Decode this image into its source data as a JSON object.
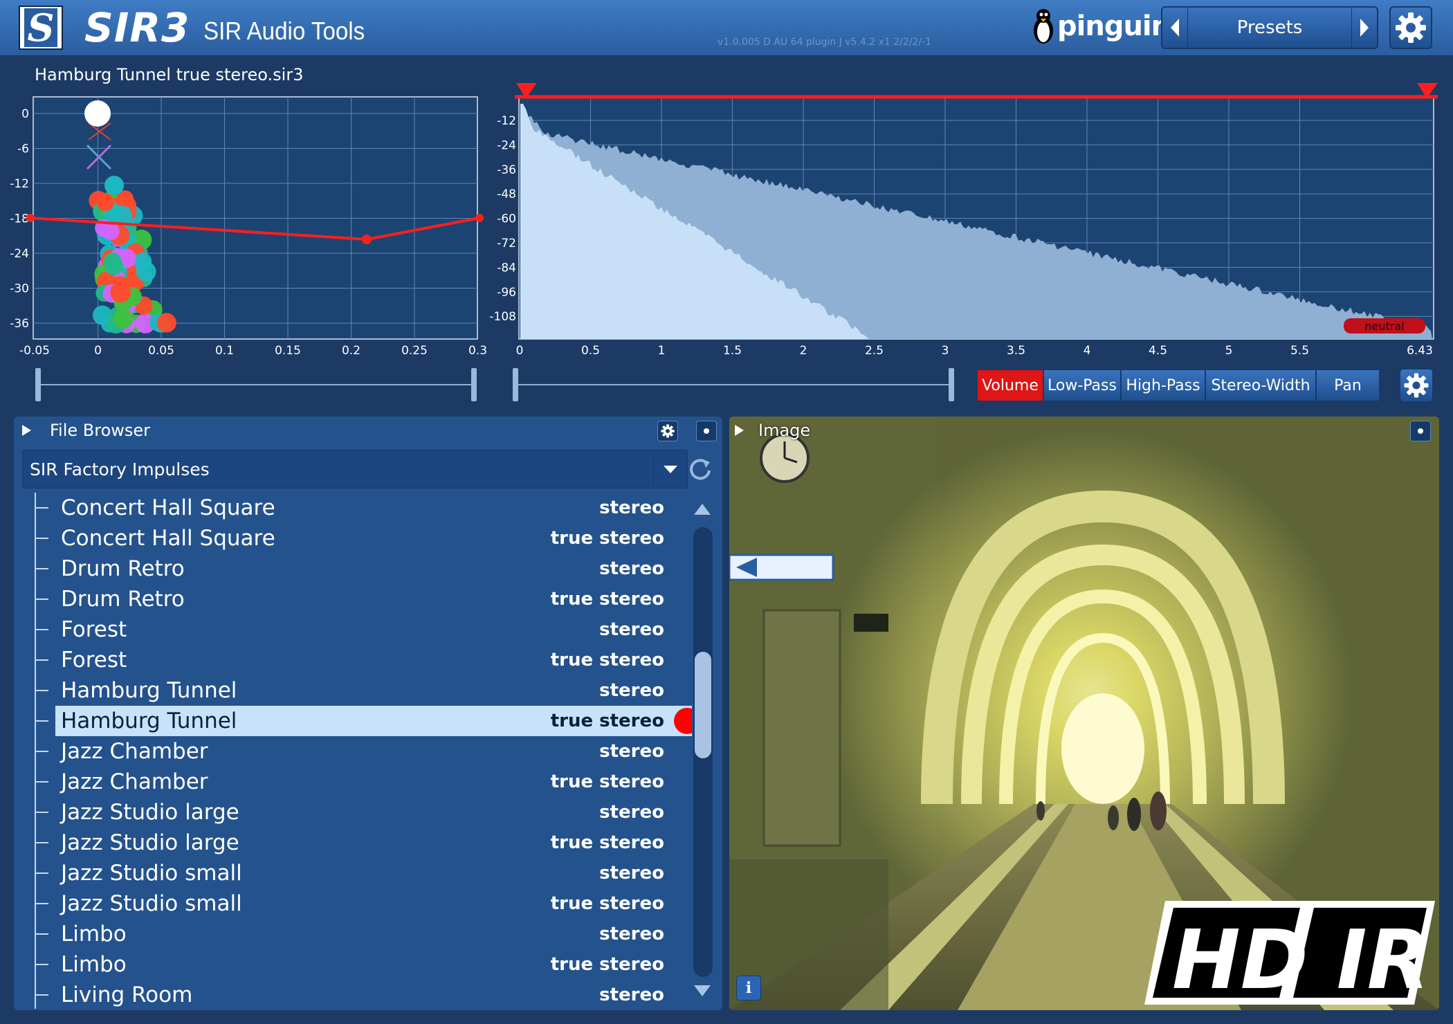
{
  "header": {
    "logo_letter": "S",
    "brand": "SIR3",
    "subtitle": "SIR Audio Tools",
    "version": "v1.0.005 D AU 64  plugin J v5.4.2 x1 2/2/2/-1",
    "pinguin": "pinguin",
    "presets_label": "Presets"
  },
  "file_title": "Hamburg Tunnel true stereo.sir3",
  "scatter": {
    "y_ticks": [
      "0",
      "-6",
      "-12",
      "-18",
      "-24",
      "-30",
      "-36"
    ],
    "x_ticks": [
      "-0.05",
      "0",
      "0.05",
      "0.1",
      "0.15",
      "0.2",
      "0.25",
      "0.3"
    ]
  },
  "envelope": {
    "y_ticks": [
      "-12",
      "-24",
      "-36",
      "-48",
      "-60",
      "-72",
      "-84",
      "-96",
      "-108"
    ],
    "x_ticks": [
      "0",
      "0.5",
      "1",
      "1.5",
      "2",
      "2.5",
      "3",
      "3.5",
      "4",
      "4.5",
      "5",
      "5.5",
      "6.43"
    ],
    "badge": "neutral"
  },
  "tabs": [
    {
      "label": "Volume",
      "active": true
    },
    {
      "label": "Low-Pass"
    },
    {
      "label": "High-Pass"
    },
    {
      "label": "Stereo-Width"
    },
    {
      "label": "Pan"
    }
  ],
  "file_browser": {
    "title": "File Browser",
    "folder": "SIR Factory Impulses",
    "rows": [
      {
        "name": "Concert Hall Square",
        "type": "stereo"
      },
      {
        "name": "Concert Hall Square",
        "type": "true stereo"
      },
      {
        "name": "Drum Retro",
        "type": "stereo"
      },
      {
        "name": "Drum Retro",
        "type": "true stereo"
      },
      {
        "name": "Forest",
        "type": "stereo"
      },
      {
        "name": "Forest",
        "type": "true stereo"
      },
      {
        "name": "Hamburg Tunnel",
        "type": "stereo"
      },
      {
        "name": "Hamburg Tunnel",
        "type": "true stereo"
      },
      {
        "name": "Jazz Chamber",
        "type": "stereo"
      },
      {
        "name": "Jazz Chamber",
        "type": "true stereo"
      },
      {
        "name": "Jazz Studio large",
        "type": "stereo"
      },
      {
        "name": "Jazz Studio large",
        "type": "true stereo"
      },
      {
        "name": "Jazz Studio small",
        "type": "stereo"
      },
      {
        "name": "Jazz Studio small",
        "type": "true stereo"
      },
      {
        "name": "Limbo",
        "type": "stereo"
      },
      {
        "name": "Limbo",
        "type": "true stereo"
      },
      {
        "name": "Living Room",
        "type": "stereo"
      }
    ]
  },
  "image_panel": {
    "title": "Image",
    "info": "i",
    "logo_text": "HD IR"
  },
  "colors": {
    "accent": "#e01515",
    "panel": "#24528c",
    "bg": "#1c3a64",
    "selection": "#c7e2f9"
  }
}
